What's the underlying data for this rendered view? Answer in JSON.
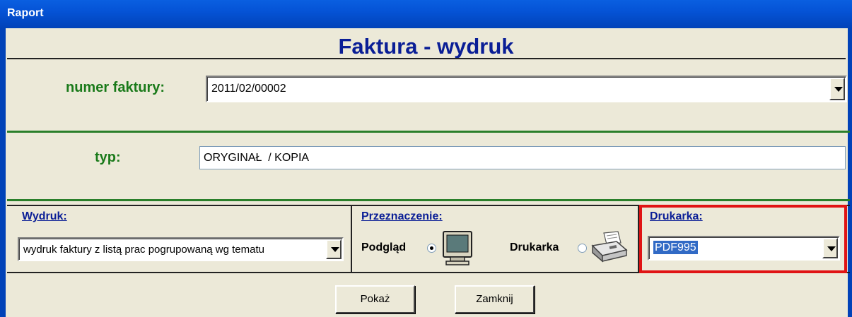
{
  "window": {
    "title": "Raport"
  },
  "form": {
    "title": "Faktura - wydruk"
  },
  "invoice": {
    "label": "numer faktury:",
    "value": "2011/02/00002"
  },
  "type": {
    "label": "typ:",
    "value": "ORYGINAŁ  / KOPIA"
  },
  "print": {
    "label": "Wydruk:",
    "value": "wydruk faktury z listą prac pogrupowaną wg tematu"
  },
  "destination": {
    "label": "Przeznaczenie:",
    "options": [
      {
        "label": "Podgląd",
        "selected": true,
        "icon": "monitor-icon"
      },
      {
        "label": "Drukarka",
        "selected": false,
        "icon": "printer-icon"
      }
    ]
  },
  "printer": {
    "label": "Drukarka:",
    "value": "PDF995"
  },
  "buttons": {
    "show": "Pokaż",
    "close": "Zamknij"
  },
  "colors": {
    "title_blue": "#0a1e96",
    "label_green": "#1a7a1a",
    "highlight_red": "#e01414",
    "window_bg": "#ece9d8"
  }
}
